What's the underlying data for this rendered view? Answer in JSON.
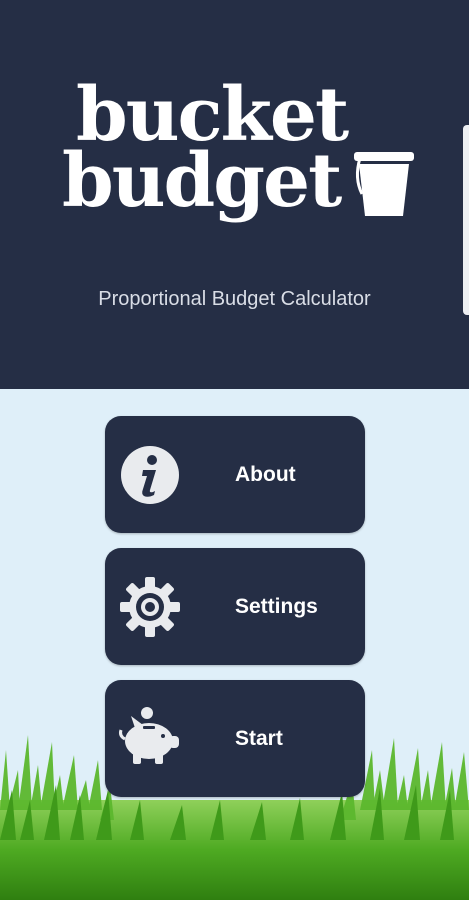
{
  "app": {
    "logo_line1": "bucket",
    "logo_line2": "budget",
    "subtitle": "Proportional Budget Calculator"
  },
  "menu": {
    "items": [
      {
        "label": "About",
        "icon": "info-icon"
      },
      {
        "label": "Settings",
        "icon": "gear-icon"
      },
      {
        "label": "Start",
        "icon": "piggy-bank-icon"
      }
    ]
  },
  "colors": {
    "header_bg": "#252e45",
    "body_bg": "#dfeff9",
    "button_bg": "#252e45",
    "grass": "#5cb82e"
  }
}
